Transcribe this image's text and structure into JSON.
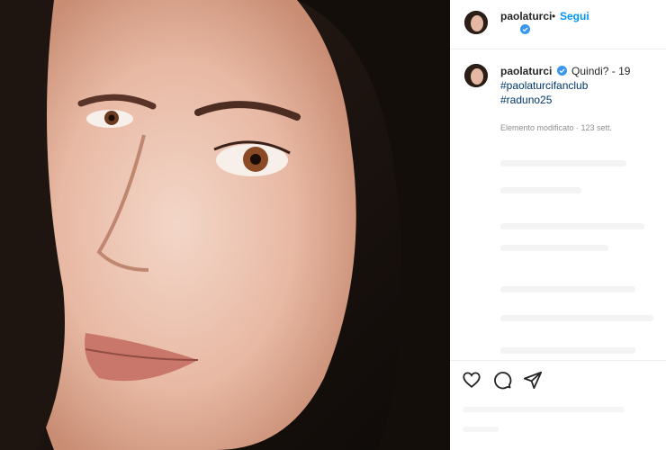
{
  "post": {
    "username": "paolaturci",
    "follow_label": "Segui",
    "separator": "•",
    "caption_text": "Quindi? - 19",
    "hashtags": [
      "#paolaturcifanclub",
      "#raduno25"
    ],
    "edited_label": "Elemento modificato · 123 sett."
  },
  "icons": {
    "verified": "verified-badge-icon",
    "like": "heart-icon",
    "comment": "comment-icon",
    "share": "paper-plane-icon"
  },
  "colors": {
    "link_blue": "#0095f6",
    "hashtag_navy": "#00376b",
    "verified_blue": "#3897f0",
    "meta_gray": "#8e8e8e"
  }
}
